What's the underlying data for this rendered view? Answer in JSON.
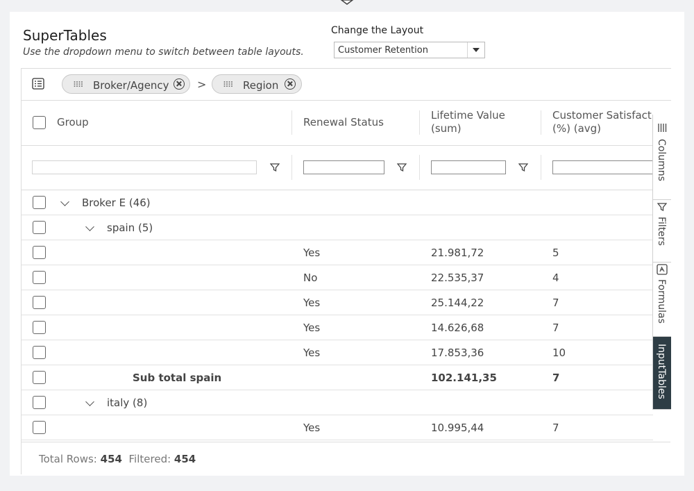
{
  "app": {
    "title": "SuperTables",
    "subtitle": "Use the dropdown menu to switch between table layouts."
  },
  "layout": {
    "label": "Change the Layout",
    "selected": "Customer Retention"
  },
  "grouping": {
    "chips": [
      {
        "label": "Broker/Agency"
      },
      {
        "label": "Region"
      }
    ],
    "separator": ">"
  },
  "columns": {
    "group": "Group",
    "renewal": "Renewal Status",
    "ltv_line1": "Lifetime Value",
    "ltv_line2": "(sum)",
    "sat_line1": "Customer Satisfact",
    "sat_line2": "(%) (avg)"
  },
  "rows": [
    {
      "type": "group1",
      "label": "Broker E (46)"
    },
    {
      "type": "group2",
      "label": "spain (5)"
    },
    {
      "type": "data",
      "renewal": "Yes",
      "ltv": "21.981,72",
      "sat": "5"
    },
    {
      "type": "data",
      "renewal": "No",
      "ltv": "22.535,37",
      "sat": "4"
    },
    {
      "type": "data",
      "renewal": "Yes",
      "ltv": "25.144,22",
      "sat": "7"
    },
    {
      "type": "data",
      "renewal": "Yes",
      "ltv": "14.626,68",
      "sat": "7"
    },
    {
      "type": "data",
      "renewal": "Yes",
      "ltv": "17.853,36",
      "sat": "10"
    },
    {
      "type": "subtotal",
      "label": "Sub total spain",
      "ltv": "102.141,35",
      "sat": "7"
    },
    {
      "type": "group2",
      "label": "italy (8)"
    },
    {
      "type": "data",
      "renewal": "Yes",
      "ltv": "10.995,44",
      "sat": "7"
    }
  ],
  "sidebar": {
    "tabs": [
      "Columns",
      "Filters",
      "Formulas",
      "InputTables"
    ],
    "active": "InputTables"
  },
  "footer": {
    "total_label": "Total Rows:",
    "total": "454",
    "filtered_label": "Filtered:",
    "filtered": "454"
  },
  "colors": {
    "accent_dark": "#2e3d45",
    "chip_bg": "#ebebeb",
    "border": "#dcdcdc"
  }
}
